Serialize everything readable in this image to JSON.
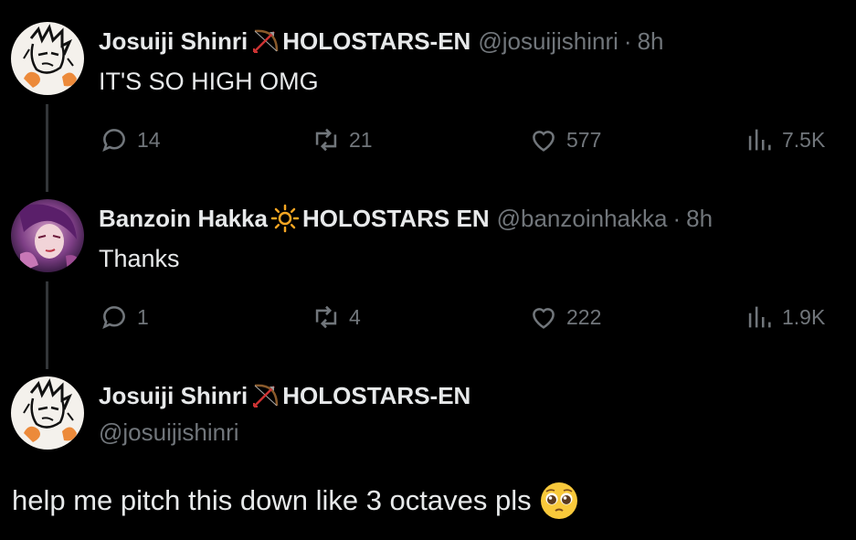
{
  "colors": {
    "background": "#000000",
    "text": "#e7e9ea",
    "muted": "#71767b",
    "thread_line": "#333639"
  },
  "tweets": [
    {
      "name": "Josuiji Shinri",
      "name_icon": "bow-and-arrow-icon",
      "affiliation": "HOLOSTARS-EN",
      "handle": "@josuijishinri",
      "separator": "·",
      "time": "8h",
      "text": "IT'S SO HIGH OMG",
      "replies": "14",
      "retweets": "21",
      "likes": "577",
      "views": "7.5K"
    },
    {
      "name": "Banzoin Hakka",
      "name_icon": "sun-icon",
      "affiliation": "HOLOSTARS EN",
      "handle": "@banzoinhakka",
      "separator": "·",
      "time": "8h",
      "text": "Thanks",
      "replies": "1",
      "retweets": "4",
      "likes": "222",
      "views": "1.9K"
    }
  ],
  "main_tweet": {
    "name": "Josuiji Shinri",
    "name_icon": "bow-and-arrow-icon",
    "affiliation": "HOLOSTARS-EN",
    "handle": "@josuijishinri",
    "text": "help me pitch this down like 3 octaves pls",
    "text_emoji": "pleading-face-icon"
  }
}
